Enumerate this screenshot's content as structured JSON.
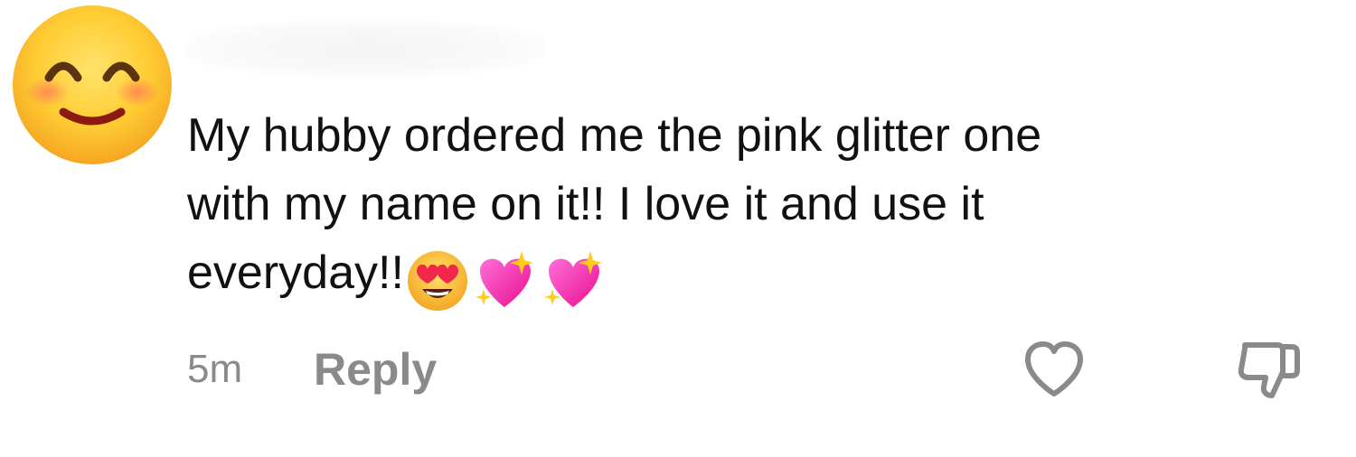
{
  "comment": {
    "lines": [
      "My hubby ordered me the pink glitter one",
      "with my name on it!! I love it and use it",
      "everyday!!"
    ],
    "trailing_emojis": [
      "heart-eyes-emoji",
      "sparkling-heart-emoji",
      "sparkling-heart-emoji"
    ]
  },
  "meta": {
    "time": "5m",
    "reply_label": "Reply"
  },
  "avatar": {
    "icon": "smiling-face-emoji"
  },
  "icons": {
    "like": "heart-outline-icon",
    "dislike": "thumbs-down-icon"
  },
  "colors": {
    "text": "#111111",
    "secondary": "#8a8a8a",
    "accent_pink": "#ff3fb4"
  }
}
